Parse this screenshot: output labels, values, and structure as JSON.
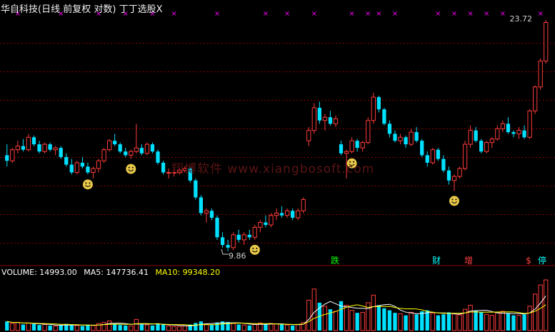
{
  "title": {
    "stock_text": "华自科技(日线 前复权 对数)",
    "indicator_text": "丁丁选股X"
  },
  "price_high_label": "23.72",
  "price_low_label": "9.86",
  "watermark": "翔博软件 www.xiangbosoft.com",
  "volume_panel": {
    "volume_label": "VOLUME: 14993.00",
    "ma5_label": "MA5: 147736.41",
    "ma10_label": "MA10: 99348.20",
    "colors": {
      "volume": "#ffffff",
      "ma5": "#ffffff",
      "ma10": "#ffff00"
    }
  },
  "badges": [
    {
      "text": "跌",
      "color": "#00ff00"
    },
    {
      "text": "财",
      "color": "#00ffff"
    },
    {
      "text": "增",
      "color": "#ff4040"
    },
    {
      "text": "$",
      "color": "#ff4040"
    },
    {
      "text": "停",
      "color": "#00ffff"
    }
  ],
  "colors": {
    "up": "#ff3b3b",
    "down": "#00e0ff",
    "grid": "#8b0000",
    "signal_marker": "#ff00ff",
    "smiley": "#e8c84a"
  },
  "signal_marker_glyph": "×",
  "smiley_icon": "smiley-icon",
  "chart_data": {
    "type": "candlestick",
    "price_range": [
      9.86,
      23.72
    ],
    "scale": "log",
    "grid": true,
    "candles": [
      [
        14.2,
        14.8,
        13.6,
        13.9
      ],
      [
        13.9,
        14.6,
        13.8,
        14.5
      ],
      [
        14.5,
        15.0,
        14.3,
        14.7
      ],
      [
        14.7,
        15.1,
        14.4,
        14.5
      ],
      [
        14.5,
        15.4,
        14.4,
        15.2
      ],
      [
        15.2,
        15.3,
        14.7,
        14.8
      ],
      [
        14.8,
        15.0,
        14.3,
        14.4
      ],
      [
        14.4,
        14.9,
        14.3,
        14.8
      ],
      [
        14.8,
        14.9,
        14.4,
        14.5
      ],
      [
        14.5,
        14.7,
        14.2,
        14.6
      ],
      [
        14.6,
        14.7,
        14.0,
        14.1
      ],
      [
        14.1,
        14.3,
        13.6,
        13.7
      ],
      [
        13.7,
        14.0,
        13.2,
        13.3
      ],
      [
        13.3,
        13.9,
        13.2,
        13.8
      ],
      [
        13.8,
        14.1,
        13.5,
        13.6
      ],
      [
        13.6,
        13.8,
        13.2,
        13.3
      ],
      [
        13.3,
        13.6,
        13.0,
        13.5
      ],
      [
        13.5,
        14.0,
        13.3,
        13.9
      ],
      [
        13.9,
        14.6,
        13.8,
        14.5
      ],
      [
        14.5,
        15.1,
        14.4,
        15.0
      ],
      [
        15.0,
        15.4,
        14.7,
        14.8
      ],
      [
        14.8,
        14.9,
        14.3,
        14.4
      ],
      [
        14.4,
        14.6,
        14.1,
        14.2
      ],
      [
        14.2,
        14.5,
        14.0,
        14.4
      ],
      [
        14.4,
        16.0,
        14.3,
        14.6
      ],
      [
        14.6,
        14.8,
        14.2,
        14.3
      ],
      [
        14.3,
        14.9,
        14.2,
        14.8
      ],
      [
        14.8,
        14.9,
        14.3,
        14.4
      ],
      [
        14.4,
        14.5,
        13.7,
        13.8
      ],
      [
        13.8,
        13.9,
        13.2,
        13.3
      ],
      [
        13.3,
        13.5,
        13.0,
        13.3
      ],
      [
        13.3,
        13.4,
        13.1,
        13.3
      ],
      [
        13.3,
        13.5,
        13.2,
        13.4
      ],
      [
        13.4,
        13.6,
        13.3,
        13.5
      ],
      [
        13.5,
        13.6,
        12.8,
        12.9
      ],
      [
        12.9,
        13.0,
        12.0,
        12.1
      ],
      [
        12.1,
        12.2,
        11.3,
        11.4
      ],
      [
        11.4,
        11.6,
        11.0,
        11.5
      ],
      [
        11.5,
        11.6,
        11.1,
        11.2
      ],
      [
        11.2,
        11.3,
        10.3,
        10.4
      ],
      [
        10.4,
        10.6,
        10.0,
        10.1
      ],
      [
        10.1,
        10.3,
        9.86,
        10.0
      ],
      [
        10.0,
        10.6,
        9.9,
        10.5
      ],
      [
        10.5,
        10.7,
        10.2,
        10.3
      ],
      [
        10.3,
        10.6,
        10.1,
        10.5
      ],
      [
        10.5,
        10.7,
        10.3,
        10.4
      ],
      [
        10.4,
        10.9,
        10.3,
        10.8
      ],
      [
        10.8,
        11.1,
        10.6,
        11.0
      ],
      [
        11.0,
        11.3,
        10.8,
        10.9
      ],
      [
        10.9,
        11.4,
        10.8,
        11.3
      ],
      [
        11.3,
        11.6,
        11.1,
        11.4
      ],
      [
        11.4,
        11.7,
        11.2,
        11.3
      ],
      [
        11.3,
        11.6,
        11.2,
        11.5
      ],
      [
        11.5,
        11.6,
        11.1,
        11.2
      ],
      [
        11.2,
        11.6,
        11.1,
        11.5
      ],
      [
        11.5,
        12.1,
        11.4,
        12.0
      ],
      [
        15.0,
        15.8,
        14.7,
        15.6
      ],
      [
        15.6,
        17.3,
        15.4,
        17.0
      ],
      [
        17.0,
        17.4,
        16.0,
        16.2
      ],
      [
        16.2,
        16.6,
        15.6,
        16.4
      ],
      [
        16.4,
        16.8,
        15.9,
        16.0
      ],
      [
        16.0,
        16.5,
        15.8,
        16.3
      ],
      [
        14.8,
        15.0,
        14.2,
        14.3
      ],
      [
        14.3,
        14.5,
        13.0,
        14.4
      ],
      [
        14.4,
        15.2,
        14.3,
        15.0
      ],
      [
        15.0,
        15.1,
        14.4,
        14.6
      ],
      [
        14.6,
        15.0,
        14.4,
        14.9
      ],
      [
        14.9,
        16.4,
        14.8,
        16.2
      ],
      [
        16.2,
        18.0,
        16.0,
        17.7
      ],
      [
        17.7,
        17.8,
        16.7,
        16.9
      ],
      [
        16.9,
        17.0,
        15.9,
        16.0
      ],
      [
        16.0,
        16.2,
        15.2,
        15.4
      ],
      [
        15.4,
        15.6,
        14.9,
        15.0
      ],
      [
        15.0,
        15.4,
        14.8,
        15.2
      ],
      [
        15.2,
        15.3,
        14.6,
        14.8
      ],
      [
        14.8,
        15.7,
        14.7,
        15.5
      ],
      [
        15.5,
        15.8,
        14.9,
        15.0
      ],
      [
        15.0,
        15.1,
        14.1,
        14.2
      ],
      [
        14.2,
        14.4,
        13.6,
        13.8
      ],
      [
        13.8,
        14.6,
        13.7,
        14.5
      ],
      [
        14.5,
        14.6,
        13.9,
        14.0
      ],
      [
        14.0,
        14.2,
        13.3,
        13.4
      ],
      [
        13.4,
        13.6,
        12.7,
        12.9
      ],
      [
        12.9,
        13.2,
        12.4,
        13.1
      ],
      [
        13.1,
        13.6,
        13.0,
        13.5
      ],
      [
        13.5,
        15.0,
        13.4,
        14.8
      ],
      [
        14.8,
        15.9,
        14.6,
        15.6
      ],
      [
        15.6,
        15.8,
        14.9,
        15.0
      ],
      [
        15.0,
        15.1,
        14.3,
        14.4
      ],
      [
        14.4,
        15.0,
        14.3,
        14.9
      ],
      [
        14.9,
        15.2,
        14.6,
        15.1
      ],
      [
        15.1,
        15.9,
        15.0,
        15.7
      ],
      [
        15.7,
        16.2,
        15.5,
        16.0
      ],
      [
        16.0,
        16.4,
        15.4,
        15.5
      ],
      [
        15.5,
        15.6,
        15.2,
        15.4
      ],
      [
        15.4,
        15.8,
        15.1,
        15.6
      ],
      [
        15.6,
        15.9,
        15.1,
        15.2
      ],
      [
        15.2,
        16.9,
        15.1,
        16.8
      ],
      [
        16.8,
        18.5,
        16.6,
        18.4
      ],
      [
        18.4,
        20.5,
        18.2,
        20.3
      ],
      [
        20.3,
        23.72,
        20.1,
        23.5
      ]
    ],
    "volume": [
      18,
      14,
      16,
      12,
      15,
      13,
      11,
      12,
      10,
      9,
      11,
      13,
      12,
      10,
      9,
      11,
      10,
      14,
      16,
      19,
      13,
      11,
      10,
      9,
      22,
      12,
      11,
      10,
      14,
      13,
      9,
      8,
      8,
      9,
      12,
      15,
      18,
      13,
      12,
      16,
      18,
      17,
      14,
      12,
      11,
      10,
      13,
      15,
      12,
      14,
      13,
      12,
      11,
      10,
      12,
      16,
      60,
      82,
      55,
      48,
      42,
      38,
      58,
      50,
      40,
      35,
      36,
      55,
      70,
      50,
      44,
      40,
      35,
      33,
      30,
      36,
      32,
      38,
      40,
      34,
      30,
      32,
      36,
      33,
      31,
      42,
      50,
      40,
      36,
      32,
      30,
      36,
      38,
      34,
      30,
      30,
      32,
      48,
      72,
      90,
      100
    ]
  }
}
